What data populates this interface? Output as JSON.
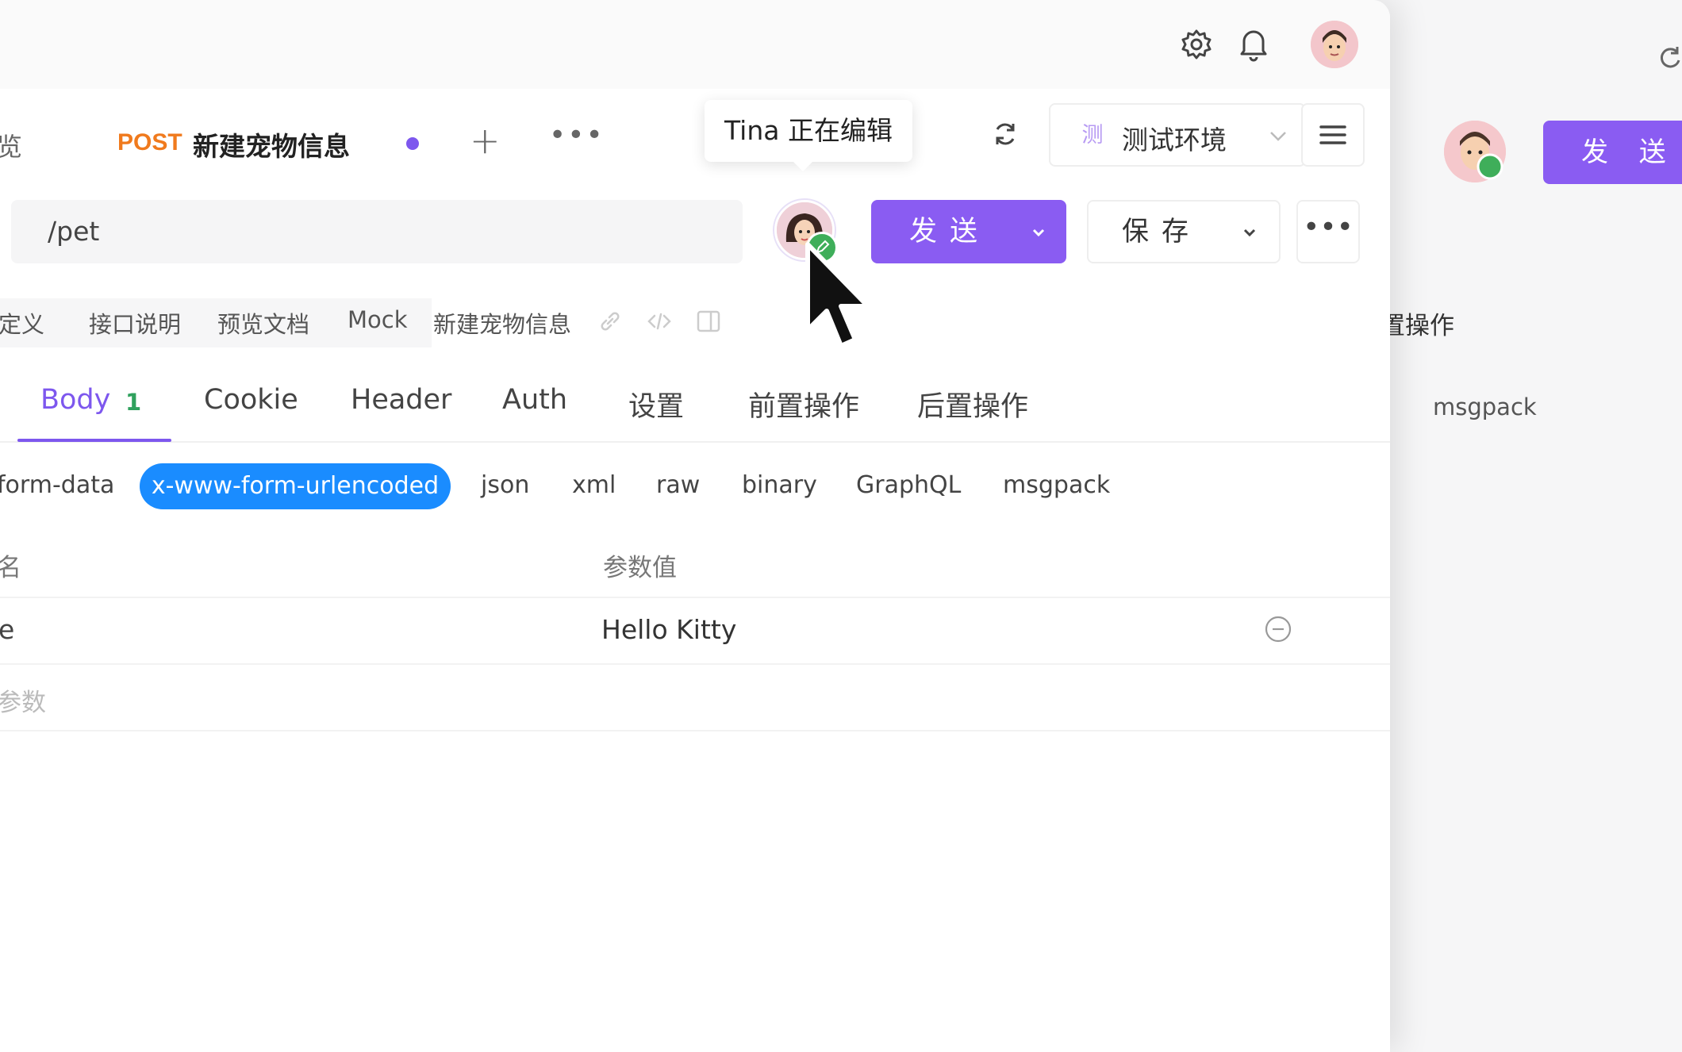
{
  "background_window": {
    "send_label": "发 送",
    "tab_label": "置操作",
    "content_type": "msgpack"
  },
  "tab": {
    "prefix": "览",
    "method": "POST",
    "title": "新建宠物信息",
    "add": "+",
    "more": "•••"
  },
  "collab": {
    "editing_tip": "Tina 正在编辑"
  },
  "environment": {
    "badge": "测",
    "label": "测试环境"
  },
  "request": {
    "url": "/pet",
    "send_label": "发送",
    "save_label": "保存",
    "more": "•••"
  },
  "subtabs": {
    "items": [
      "定义",
      "接口说明",
      "预览文档",
      "Mock",
      "新建宠物信息"
    ]
  },
  "body_tabs": {
    "items": [
      "Body",
      "Cookie",
      "Header",
      "Auth",
      "设置",
      "前置操作",
      "后置操作"
    ],
    "body_count": "1"
  },
  "content_types": {
    "items": [
      "form-data",
      "x-www-form-urlencoded",
      "json",
      "xml",
      "raw",
      "binary",
      "GraphQL",
      "msgpack"
    ],
    "active": "x-www-form-urlencoded"
  },
  "params": {
    "header_name": "名",
    "header_value": "参数值",
    "rows": [
      {
        "key": "e",
        "value": "Hello Kitty"
      }
    ],
    "add_placeholder": "参数"
  },
  "colors": {
    "accent": "#8a5cf2",
    "method_post": "#f07a1d",
    "content_type_active": "#1a8cff",
    "count_green": "#2fa15d"
  }
}
